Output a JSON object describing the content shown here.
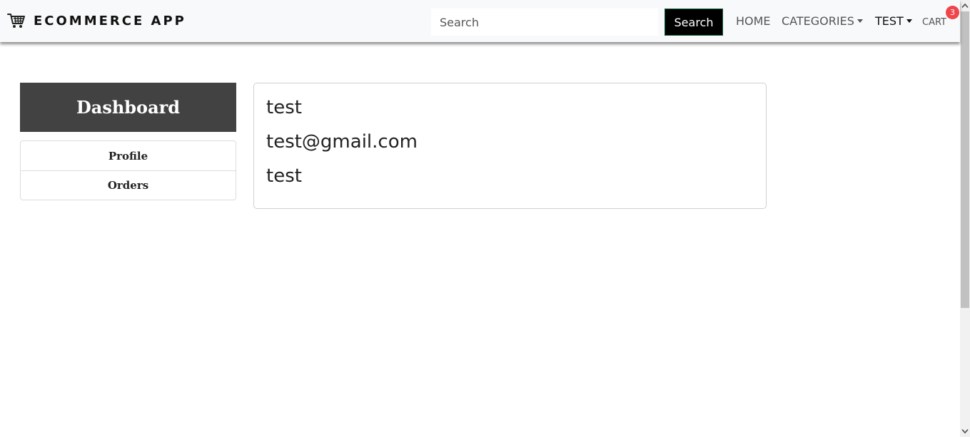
{
  "navbar": {
    "brand_icon": "shopping-cart-icon",
    "brand_text": "ECOMMERCE APP",
    "search": {
      "placeholder": "Search",
      "value": "",
      "button_label": "Search"
    },
    "links": {
      "home": "HOME",
      "categories": "CATEGORIES",
      "user": "TEST",
      "cart": "CART"
    },
    "cart_count": "3",
    "badge_color": "#f0454a"
  },
  "sidebar": {
    "title": "Dashboard",
    "items": [
      {
        "label": "Profile"
      },
      {
        "label": "Orders"
      }
    ]
  },
  "profile": {
    "name": "test",
    "email": "test@gmail.com",
    "address": "test"
  },
  "colors": {
    "sidebar_header_bg": "#424242",
    "search_button_bg": "#000000",
    "navbar_bg": "#f8f9fa"
  }
}
